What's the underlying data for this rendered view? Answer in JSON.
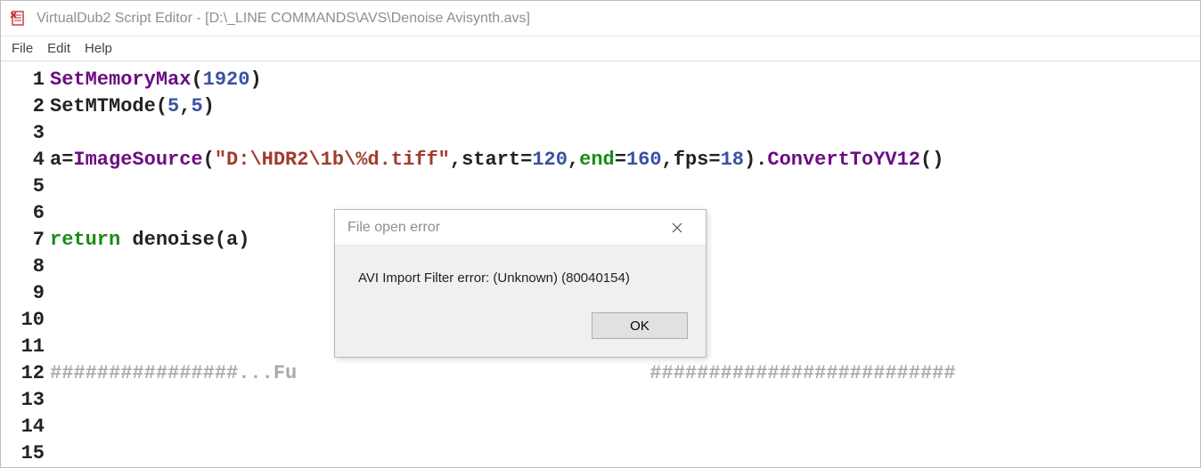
{
  "window": {
    "title": "VirtualDub2 Script Editor - [D:\\_LINE COMMANDS\\AVS\\Denoise Avisynth.avs]"
  },
  "menu": {
    "file": "File",
    "edit": "Edit",
    "help": "Help"
  },
  "code": {
    "lines": [
      {
        "n": "1",
        "tokens": [
          {
            "t": "SetMemoryMax",
            "c": "func"
          },
          {
            "t": "(",
            "c": "punc"
          },
          {
            "t": "1920",
            "c": "num"
          },
          {
            "t": ")",
            "c": "punc"
          }
        ]
      },
      {
        "n": "2",
        "tokens": [
          {
            "t": "SetMTMode",
            "c": "plain"
          },
          {
            "t": "(",
            "c": "punc"
          },
          {
            "t": "5",
            "c": "num"
          },
          {
            "t": ",",
            "c": "punc"
          },
          {
            "t": "5",
            "c": "num"
          },
          {
            "t": ")",
            "c": "punc"
          }
        ]
      },
      {
        "n": "3",
        "tokens": []
      },
      {
        "n": "4",
        "tokens": [
          {
            "t": "a",
            "c": "plain"
          },
          {
            "t": "=",
            "c": "punc"
          },
          {
            "t": "ImageSource",
            "c": "func"
          },
          {
            "t": "(",
            "c": "punc"
          },
          {
            "t": "\"D:\\HDR2\\1b\\%d.tiff\"",
            "c": "str"
          },
          {
            "t": ",",
            "c": "punc"
          },
          {
            "t": "start",
            "c": "plain"
          },
          {
            "t": "=",
            "c": "punc"
          },
          {
            "t": "120",
            "c": "num"
          },
          {
            "t": ",",
            "c": "punc"
          },
          {
            "t": "end",
            "c": "kw"
          },
          {
            "t": "=",
            "c": "punc"
          },
          {
            "t": "160",
            "c": "num"
          },
          {
            "t": ",",
            "c": "punc"
          },
          {
            "t": "fps",
            "c": "plain"
          },
          {
            "t": "=",
            "c": "punc"
          },
          {
            "t": "18",
            "c": "num"
          },
          {
            "t": ")",
            "c": "punc"
          },
          {
            "t": ".",
            "c": "punc"
          },
          {
            "t": "ConvertToYV12",
            "c": "func"
          },
          {
            "t": "()",
            "c": "punc"
          }
        ]
      },
      {
        "n": "5",
        "tokens": []
      },
      {
        "n": "6",
        "tokens": []
      },
      {
        "n": "7",
        "tokens": [
          {
            "t": "return",
            "c": "kw"
          },
          {
            "t": " denoise",
            "c": "plain"
          },
          {
            "t": "(",
            "c": "punc"
          },
          {
            "t": "a",
            "c": "plain"
          },
          {
            "t": ")",
            "c": "punc"
          }
        ]
      },
      {
        "n": "8",
        "tokens": []
      },
      {
        "n": "9",
        "tokens": []
      },
      {
        "n": "10",
        "tokens": []
      },
      {
        "n": "11",
        "tokens": []
      },
      {
        "n": "12",
        "tokens": [
          {
            "t": "################...Fu                              ##########################",
            "c": "comment"
          }
        ]
      },
      {
        "n": "13",
        "tokens": []
      },
      {
        "n": "14",
        "tokens": []
      },
      {
        "n": "15",
        "tokens": []
      }
    ]
  },
  "dialog": {
    "title": "File open error",
    "message": "AVI Import Filter error: (Unknown) (80040154)",
    "ok": "OK"
  }
}
